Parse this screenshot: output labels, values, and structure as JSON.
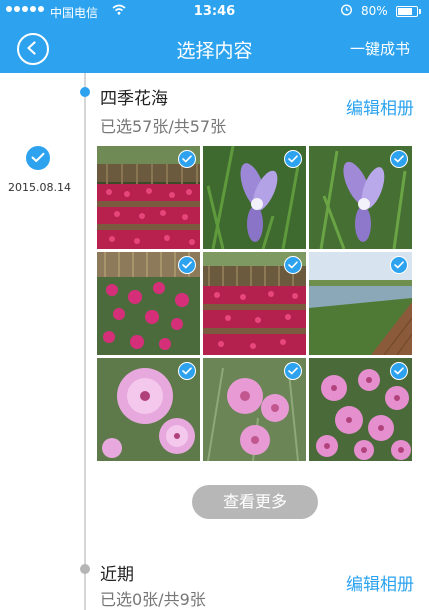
{
  "status_bar": {
    "carrier": "中国电信",
    "time": "13:46",
    "battery": "80%",
    "battery_level": 0.8
  },
  "nav": {
    "title": "选择内容",
    "action": "一键成书"
  },
  "timeline": {
    "date": "2015.08.14"
  },
  "groups": [
    {
      "title": "四季花海",
      "subtitle": "已选57张/共57张",
      "edit": "编辑相册"
    },
    {
      "title": "近期",
      "subtitle": "已选0张/共9张",
      "edit": "编辑相册"
    }
  ],
  "more_button": "查看更多",
  "colors": {
    "accent": "#2da3f0",
    "timeline_line": "#d6d6d6",
    "button_gray": "#b7b7b7"
  },
  "photos": [
    {
      "subject": "flowerbed-fence",
      "selected": true
    },
    {
      "subject": "purple-iris",
      "selected": true
    },
    {
      "subject": "purple-iris",
      "selected": true
    },
    {
      "subject": "pink-dianthus-fence",
      "selected": true
    },
    {
      "subject": "flowerbed-fence",
      "selected": true
    },
    {
      "subject": "pond-boardwalk",
      "selected": true
    },
    {
      "subject": "pink-dianthus-closeup",
      "selected": true
    },
    {
      "subject": "pink-dianthus",
      "selected": true
    },
    {
      "subject": "pink-dianthus-cluster",
      "selected": true
    }
  ]
}
